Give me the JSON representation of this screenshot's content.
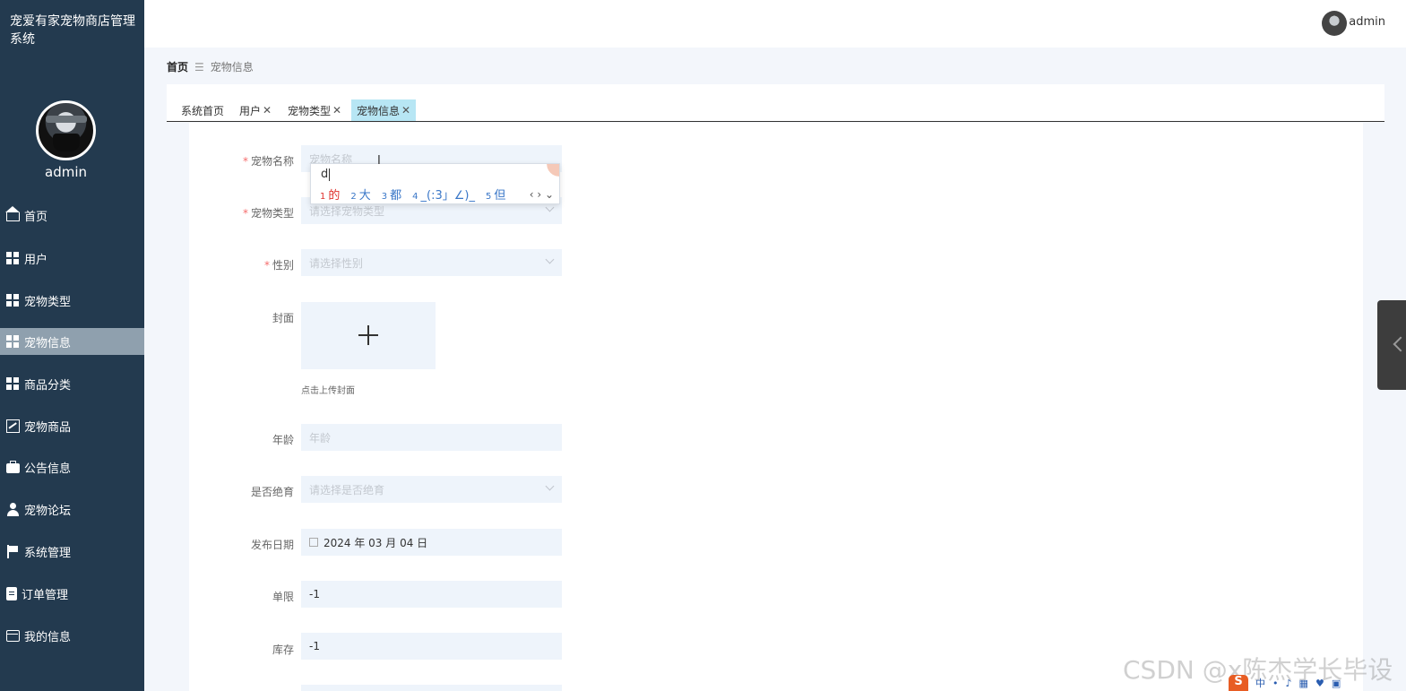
{
  "app": {
    "title": "宠爱有家宠物商店管理系统",
    "user_name": "admin"
  },
  "header": {
    "user_name": "admin"
  },
  "sidebar": {
    "items": [
      {
        "label": "首页",
        "icon": "home-icon"
      },
      {
        "label": "用户",
        "icon": "grid-icon"
      },
      {
        "label": "宠物类型",
        "icon": "grid-icon"
      },
      {
        "label": "宠物信息",
        "icon": "grid-icon",
        "active": true
      },
      {
        "label": "商品分类",
        "icon": "grid-icon"
      },
      {
        "label": "宠物商品",
        "icon": "chart-icon"
      },
      {
        "label": "公告信息",
        "icon": "briefcase-icon"
      },
      {
        "label": "宠物论坛",
        "icon": "person-icon"
      },
      {
        "label": "系统管理",
        "icon": "flag-icon"
      },
      {
        "label": "订单管理",
        "icon": "clipboard-icon"
      },
      {
        "label": "我的信息",
        "icon": "card-icon"
      }
    ]
  },
  "breadcrumb": {
    "home": "首页",
    "separator": "☰",
    "current": "宠物信息"
  },
  "tabs": [
    {
      "label": "系统首页",
      "closable": false
    },
    {
      "label": "用户",
      "closable": true
    },
    {
      "label": "宠物类型",
      "closable": true
    },
    {
      "label": "宠物信息",
      "closable": true,
      "active": true
    }
  ],
  "tab_close_glyph": "✕",
  "form": {
    "pet_name": {
      "label": "宠物名称",
      "required": true,
      "placeholder": "宠物名称",
      "value": ""
    },
    "pet_type": {
      "label": "宠物类型",
      "required": true,
      "placeholder": "请选择宠物类型"
    },
    "gender": {
      "label": "性别",
      "required": true,
      "placeholder": "请选择性别"
    },
    "cover": {
      "label": "封面",
      "hint": "点击上传封面"
    },
    "age": {
      "label": "年龄",
      "placeholder": "年龄"
    },
    "sterilized": {
      "label": "是否绝育",
      "placeholder": "请选择是否绝育"
    },
    "publish_date": {
      "label": "发布日期",
      "value": "2024 年 03 月 04 日"
    },
    "limit": {
      "label": "单限",
      "value": "-1"
    },
    "stock": {
      "label": "库存",
      "value": "-1"
    }
  },
  "required_mark": "*",
  "ime": {
    "typed": "d",
    "candidates": [
      {
        "num": "1",
        "text": "的"
      },
      {
        "num": "2",
        "text": "大"
      },
      {
        "num": "3",
        "text": "都"
      },
      {
        "num": "4",
        "text": "_(:3」∠)_"
      },
      {
        "num": "5",
        "text": "但"
      }
    ],
    "nav": "‹ › ⌄"
  },
  "text_cursor": "I",
  "watermark": "CSDN @x陈杰学长毕设",
  "tray": {
    "logo": "S",
    "lang": "中"
  },
  "colors": {
    "sidebar_bg": "#233a4f",
    "active_menu_bg": "#8fa0ae",
    "active_tab_bg": "#b7e6f4",
    "input_bg": "#eef4fb",
    "required": "#f56c6c"
  }
}
